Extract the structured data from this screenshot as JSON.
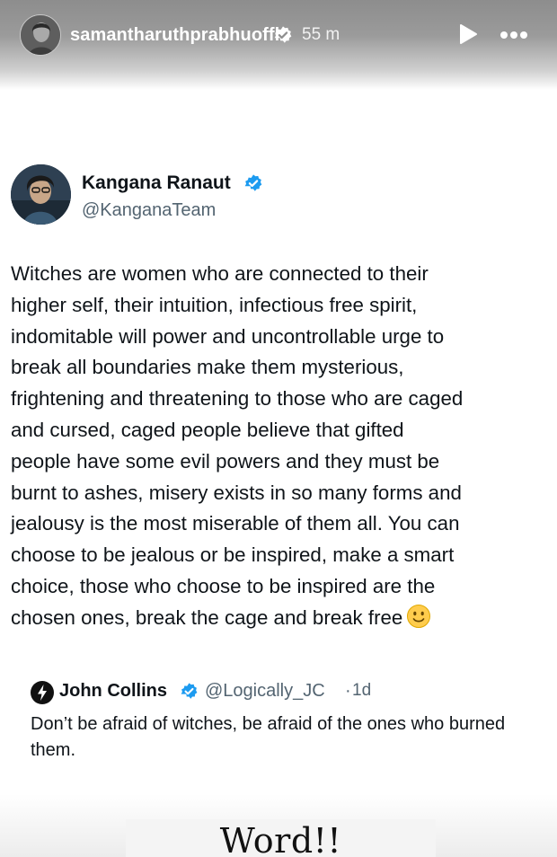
{
  "story": {
    "username": "samantharuthprabhuoffl",
    "time": "55 m",
    "caption": "Word!!"
  },
  "tweet": {
    "author_name": "Kangana Ranaut",
    "handle": "@KanganaTeam",
    "text": "Witches are women who are connected to their\nhigher self, their intuition, infectious free spirit,\nindomitable will power and uncontrollable urge to\nbreak all boundaries make them mysterious,\nfrightening and threatening to those who are caged\nand cursed, caged people believe that gifted\npeople have some evil powers and they must be\nburnt to ashes, misery exists in so many forms and\njealousy is the most miserable of them all. You can\nchoose to be jealous or be inspired, make a smart\nchoice, those who choose to be inspired are the\nchosen ones, break the cage and break free",
    "emoji": "slightly-smiling-face-icon"
  },
  "quoted_tweet": {
    "author_name": "John Collins",
    "handle": "@Logically_JC",
    "separator": "·",
    "age": "1d",
    "text": "Don’t be afraid of witches, be afraid of the ones who burned them."
  },
  "colors": {
    "verified_blue": "#1d9bf0",
    "handle_gray": "#536471",
    "text_dark": "#0f1419",
    "emoji_yellow": "#ffcc4d"
  },
  "icons": [
    "verified-badge-icon",
    "play-icon",
    "more-options-icon",
    "slightly-smiling-face-icon",
    "lightning-logo-icon"
  ]
}
